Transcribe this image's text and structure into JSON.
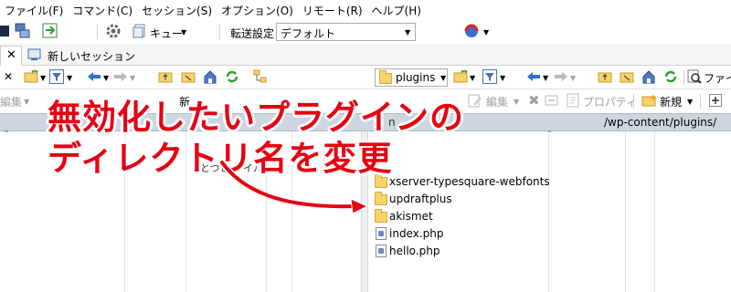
{
  "menu": [
    "ファイル(F)",
    "コマンド(C)",
    "セッション(S)",
    "オプション(O)",
    "リモート(R)",
    "ヘルプ(H)"
  ],
  "toolbar": {
    "queue_label": "キュー",
    "transfer_settings_label": "転送設定",
    "transfer_settings_value": "デフォルト"
  },
  "tabs": {
    "new_session_label": "新しいセッション"
  },
  "remote": {
    "current_dir": "plugins",
    "path": "/wp-content/plugins/",
    "find_label": "ファイ",
    "edit_label": "編集",
    "properties_label": "プロパティ",
    "new_label": "新規"
  },
  "local": {
    "edit_label": "編集",
    "partial_text": "新",
    "partial_label": "とつと  ァイル"
  },
  "files": [
    {
      "name": "xserver-typesquare-webfonts",
      "type": "folder"
    },
    {
      "name": "updraftplus",
      "type": "folder"
    },
    {
      "name": "akismet",
      "type": "folder"
    },
    {
      "name": "index.php",
      "type": "php"
    },
    {
      "name": "hello.php",
      "type": "php"
    }
  ],
  "annotation": {
    "line1": "無効化したいプラグインの",
    "line2": "ディレクトリ名を変更",
    "color": "#e60012"
  }
}
